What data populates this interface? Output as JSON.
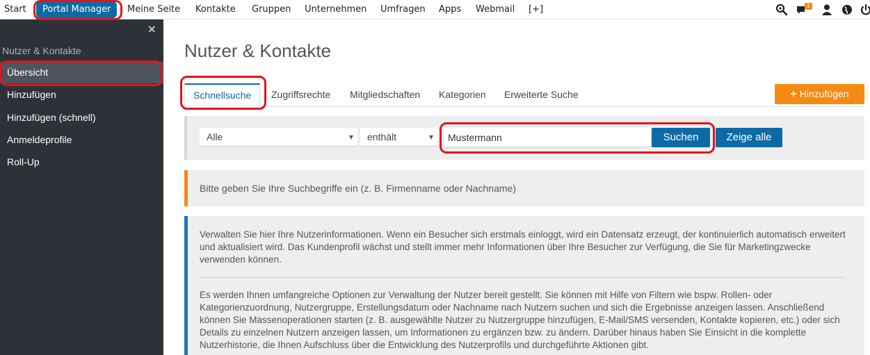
{
  "topnav": {
    "items": [
      "Start",
      "Portal Manager",
      "Meine Seite",
      "Kontakte",
      "Gruppen",
      "Unternehmen",
      "Umfragen",
      "Apps",
      "Webmail",
      "[+]"
    ],
    "active": "Portal Manager",
    "notification_count": "1",
    "accent": "#0e6aa5"
  },
  "sidebar": {
    "close_label": "×",
    "section_title": "Nutzer & Kontakte",
    "items": [
      "Übersicht",
      "Hinzufügen",
      "Hinzufügen (schnell)",
      "Anmeldeprofile",
      "Roll-Up"
    ]
  },
  "main": {
    "title": "Nutzer & Kontakte",
    "tabs": [
      "Schnellsuche",
      "Zugriffsrechte",
      "Mitgliedschaften",
      "Kategorien",
      "Erweiterte Suche"
    ],
    "add_button": "Hinzufügen",
    "search": {
      "field_select": "Alle",
      "operator_select": "enthält",
      "query_value": "Mustermann",
      "search_button": "Suchen",
      "show_all_button": "Zeige alle"
    },
    "hint": "Bitte geben Sie Ihre Suchbegriffe ein (z. B. Firmenname oder Nachname)",
    "info_p1": "Verwalten Sie hier Ihre Nutzerinformationen. Wenn ein Besucher sich erstmals einloggt, wird ein Datensatz erzeugt, der kontinuierlich automatisch erweitert und aktualisiert wird. Das Kundenprofil wächst und stellt immer mehr Informationen über Ihre Besucher zur Verfügung, die Sie für Marketingzwecke verwenden können.",
    "info_p2": "Es werden Ihnen umfangreiche Optionen zur Verwaltung der Nutzer bereit gestellt. Sie können mit Hilfe von Filtern wie bspw. Rollen- oder Kategorienzuordnung, Nutzergruppe, Erstellungsdatum oder Nachname nach Nutzern suchen und sich die Ergebnisse anzeigen lassen. Anschließend können Sie Massenoperationen starten (z. B. ausgewählte Nutzer zu Nutzergruppe hinzufügen, E-Mail/SMS versenden, Kontakte kopieren, etc.) oder sich Details zu einzelnen Nutzern anzeigen lassen, um Informationen zu ergänzen bzw. zu ändern. Darüber hinaus haben Sie Einsicht in die komplette Nutzerhistorie, die Ihnen Aufschluss über die Entwicklung des Nutzerprofils und durchgeführte Aktionen gibt."
  },
  "colors": {
    "orange": "#f58a12",
    "blue": "#0e6aa5",
    "highlight": "#e0141e",
    "sidebar_bg": "#2d3238"
  }
}
